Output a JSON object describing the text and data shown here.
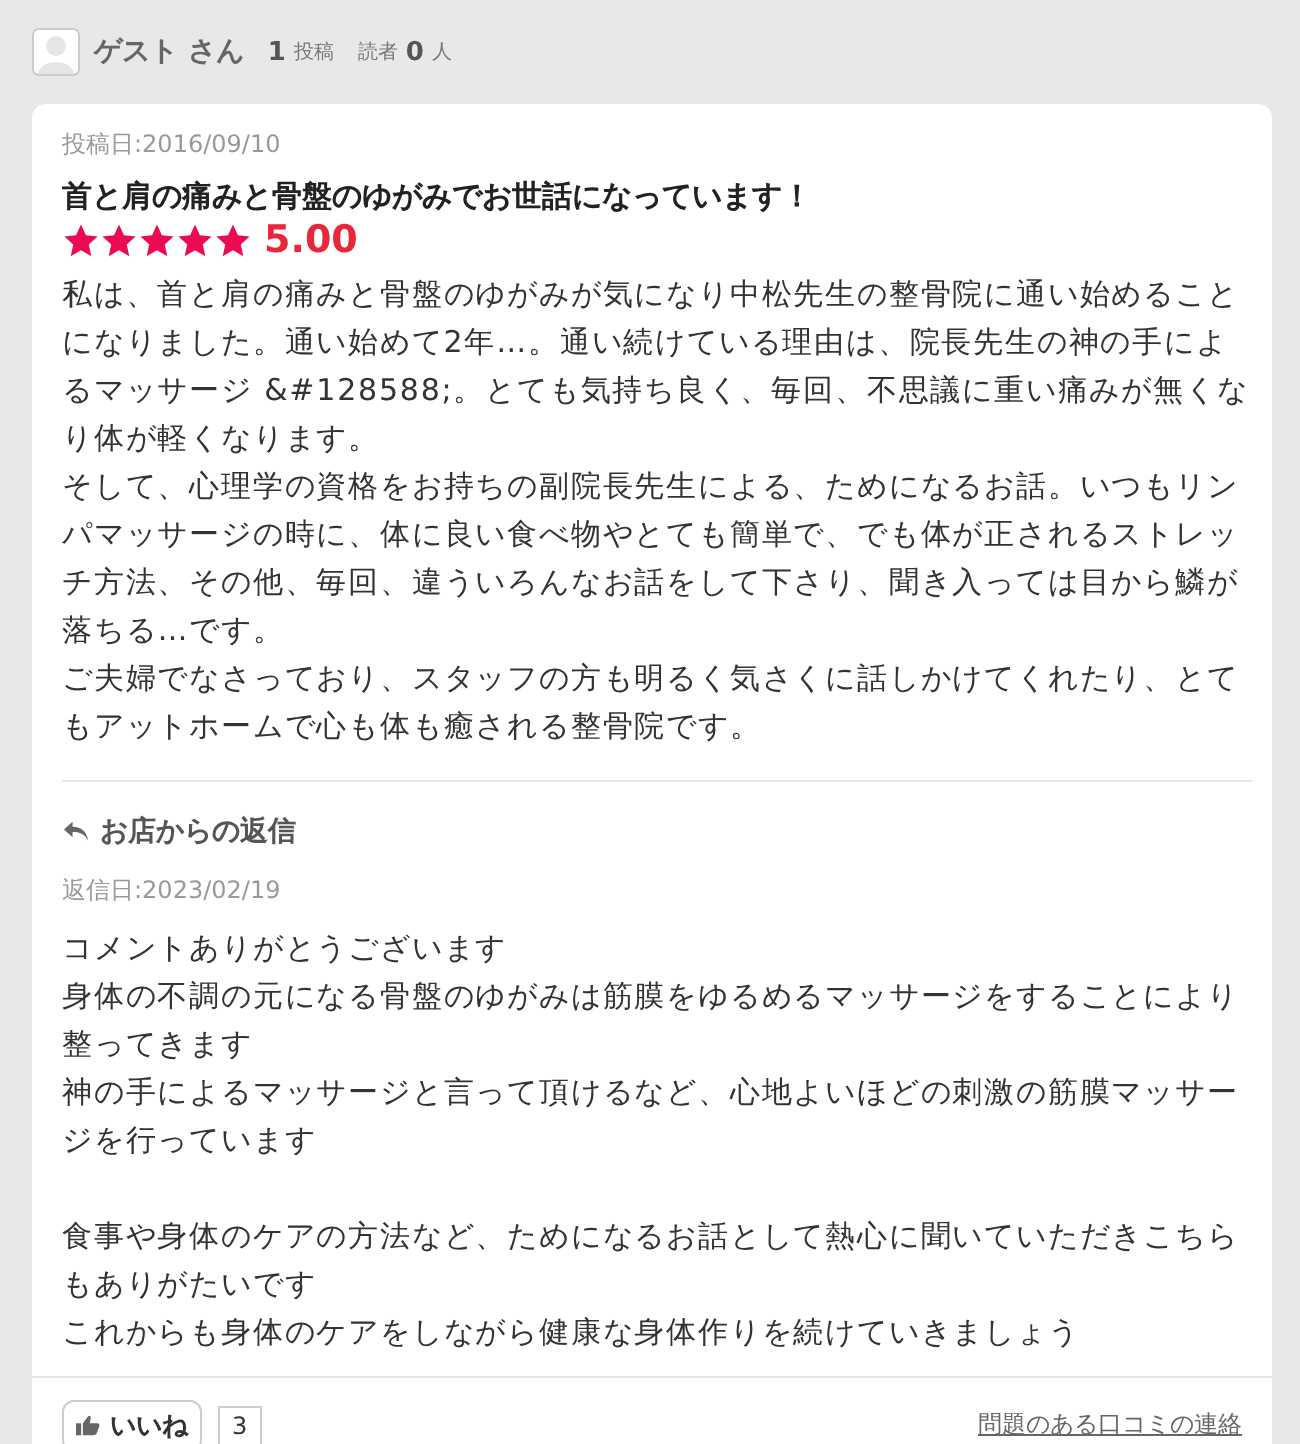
{
  "user": {
    "name": "ゲスト さん",
    "posts_count": "1",
    "posts_label": "投稿",
    "readers_label": "読者",
    "readers_count": "0",
    "readers_unit": "人"
  },
  "review": {
    "date": "投稿日:2016/09/10",
    "title": "首と肩の痛みと骨盤のゆがみでお世話になっています！",
    "stars": 5,
    "rating": "5.00",
    "paragraphs": [
      "私は、首と肩の痛みと骨盤のゆがみが気になり中松先生の整骨院に通い始めることになりました。通い始めて2年…。通い続けている理由は、院長先生の神の手によるマッサージ &#128588;。とても気持ち良く、毎回、不思議に重い痛みが無くなり体が軽くなります。",
      "そして、心理学の資格をお持ちの副院長先生による、ためになるお話。いつもリンパマッサージの時に、体に良い食べ物やとても簡単で、でも体が正されるストレッチ方法、その他、毎回、違ういろんなお話をして下さり、聞き入っては目から鱗が落ちる…です。",
      "ご夫婦でなさっており、スタッフの方も明るく気さくに話しかけてくれたり、とてもアットホームで心も体も癒される整骨院です。"
    ]
  },
  "reply": {
    "heading": "お店からの返信",
    "date": "返信日:2023/02/19",
    "blocks": [
      [
        "コメントありがとうございます",
        "身体の不調の元になる骨盤のゆがみは筋膜をゆるめるマッサージをすることにより整ってきます",
        "神の手によるマッサージと言って頂けるなど、心地よいほどの刺激の筋膜マッサージを行っています"
      ],
      [
        "食事や身体のケアの方法など、ためになるお話として熱心に聞いていただきこちらもありがたいです",
        "これからも身体のケアをしながら健康な身体作りを続けていきましょう"
      ]
    ]
  },
  "footer": {
    "like_label": "いいね",
    "like_count": "3",
    "report_link": "問題のある口コミの連絡"
  }
}
